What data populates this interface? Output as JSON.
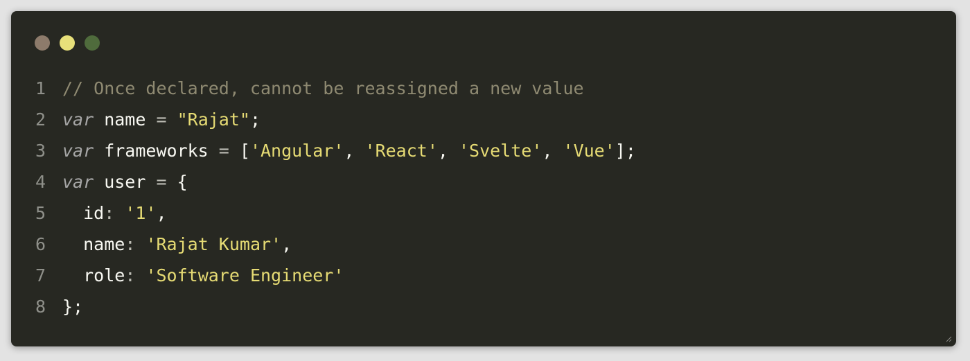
{
  "colors": {
    "background": "#272822",
    "page": "#e3e3e3",
    "dot_close": "#8d7b6b",
    "dot_minimize": "#e7e07a",
    "dot_zoom": "#4f6b3c",
    "comment": "#8f8a72",
    "keyword": "#a6a6a6",
    "string": "#e6db74",
    "plain": "#f8f8f2",
    "operator": "#bdbdb5",
    "line_number": "#8f908a"
  },
  "window": {
    "controls": [
      "close-dot",
      "minimize-dot",
      "zoom-dot"
    ]
  },
  "code": {
    "lines": [
      {
        "number": "1",
        "tokens": [
          {
            "t": "// Once declared, cannot be reassigned a new value",
            "k": "comment"
          }
        ]
      },
      {
        "number": "2",
        "tokens": [
          {
            "t": "var",
            "k": "keyword"
          },
          {
            "t": " name ",
            "k": "plain"
          },
          {
            "t": "=",
            "k": "operator"
          },
          {
            "t": " ",
            "k": "plain"
          },
          {
            "t": "\"Rajat\"",
            "k": "string"
          },
          {
            "t": ";",
            "k": "plain"
          }
        ]
      },
      {
        "number": "3",
        "tokens": [
          {
            "t": "var",
            "k": "keyword"
          },
          {
            "t": " frameworks ",
            "k": "plain"
          },
          {
            "t": "=",
            "k": "operator"
          },
          {
            "t": " [",
            "k": "plain"
          },
          {
            "t": "'Angular'",
            "k": "string"
          },
          {
            "t": ", ",
            "k": "plain"
          },
          {
            "t": "'React'",
            "k": "string"
          },
          {
            "t": ", ",
            "k": "plain"
          },
          {
            "t": "'Svelte'",
            "k": "string"
          },
          {
            "t": ", ",
            "k": "plain"
          },
          {
            "t": "'Vue'",
            "k": "string"
          },
          {
            "t": "];",
            "k": "plain"
          }
        ]
      },
      {
        "number": "4",
        "tokens": [
          {
            "t": "var",
            "k": "keyword"
          },
          {
            "t": " user ",
            "k": "plain"
          },
          {
            "t": "=",
            "k": "operator"
          },
          {
            "t": " {",
            "k": "plain"
          }
        ]
      },
      {
        "number": "5",
        "tokens": [
          {
            "t": "  id",
            "k": "plain"
          },
          {
            "t": ":",
            "k": "operator"
          },
          {
            "t": " ",
            "k": "plain"
          },
          {
            "t": "'1'",
            "k": "string"
          },
          {
            "t": ",",
            "k": "plain"
          }
        ]
      },
      {
        "number": "6",
        "tokens": [
          {
            "t": "  name",
            "k": "plain"
          },
          {
            "t": ":",
            "k": "operator"
          },
          {
            "t": " ",
            "k": "plain"
          },
          {
            "t": "'Rajat Kumar'",
            "k": "string"
          },
          {
            "t": ",",
            "k": "plain"
          }
        ]
      },
      {
        "number": "7",
        "tokens": [
          {
            "t": "  role",
            "k": "plain"
          },
          {
            "t": ":",
            "k": "operator"
          },
          {
            "t": " ",
            "k": "plain"
          },
          {
            "t": "'Software Engineer'",
            "k": "string"
          }
        ]
      },
      {
        "number": "8",
        "tokens": [
          {
            "t": "};",
            "k": "plain"
          }
        ]
      }
    ]
  },
  "icons": {
    "resize": "resize-grip-icon"
  }
}
